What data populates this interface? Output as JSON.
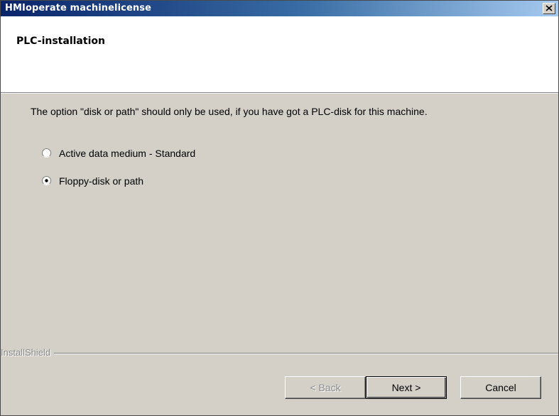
{
  "window": {
    "title": "HMIoperate machinelicense",
    "close_icon": "close-icon"
  },
  "header": {
    "title": "PLC-installation"
  },
  "main": {
    "info_text": "The option \"disk or path\" should only be used, if you have got a PLC-disk for this machine.",
    "options": [
      {
        "label": "Active data medium - Standard",
        "selected": false
      },
      {
        "label": "Floppy-disk or path",
        "selected": true
      }
    ]
  },
  "footer": {
    "brand": "InstallShield",
    "back_label": "< Back",
    "back_enabled": false,
    "next_label": "Next >",
    "cancel_label": "Cancel"
  },
  "colors": {
    "title_start": "#0a246a",
    "title_end": "#a6caf0",
    "face": "#d4d0c8",
    "header_bg": "#ffffff",
    "disabled_text": "#8c8c8c"
  }
}
